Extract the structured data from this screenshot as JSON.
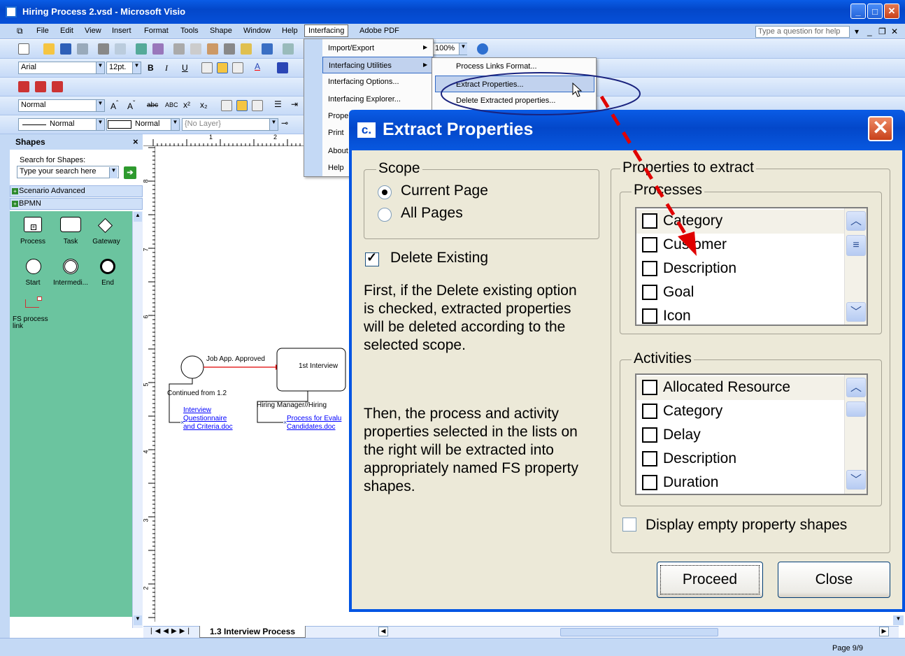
{
  "window": {
    "title": "Hiring Process 2.vsd - Microsoft Visio"
  },
  "menubar": {
    "items": [
      "File",
      "Edit",
      "View",
      "Insert",
      "Format",
      "Tools",
      "Shape",
      "Window",
      "Help",
      "Interfacing",
      "Adobe PDF"
    ],
    "help_placeholder": "Type a question for help"
  },
  "toolbar": {
    "zoom": "100%",
    "font": "Arial",
    "size": "12pt.",
    "style": "Normal",
    "line_style": "Normal",
    "fill_style": "Normal",
    "layer": "{No Layer}"
  },
  "interfacing_menu": [
    "Import/Export",
    "Interfacing Utilities",
    "Interfacing Options...",
    "Interfacing Explorer...",
    "Proper",
    "Print",
    "About",
    "Help"
  ],
  "utilities_menu": [
    "Process Links Format...",
    "Extract Properties...",
    "Delete Extracted properties..."
  ],
  "shapes_pane": {
    "title": "Shapes",
    "search_label": "Search for Shapes:",
    "search_placeholder": "Type your search here",
    "stencils": [
      "Scenario Advanced",
      "BPMN"
    ],
    "shapes": [
      "Process",
      "Task",
      "Gateway",
      "Start",
      "Intermedi...",
      "End",
      "FS process link"
    ]
  },
  "canvas": {
    "ruler_marks_h": [
      "1",
      "2"
    ],
    "ruler_marks_v": [
      "8",
      "7",
      "6",
      "5",
      "4",
      "3",
      "2"
    ],
    "edge_label": "Job App. Approved",
    "task_label": "1st Interview",
    "continued": "Continued from 1.2",
    "link1": [
      "Interview",
      "Questionnaire",
      "and Criteria.doc"
    ],
    "hiring": "Hiring Manager//Hiring",
    "link2": [
      "Process for Evalu",
      "Candidates.doc"
    ]
  },
  "page_tab": "1.3 Interview Process",
  "status": {
    "page": "Page 9/9"
  },
  "dialog": {
    "title": "Extract Properties",
    "scope_label": "Scope",
    "scope_options": [
      "Current Page",
      "All Pages"
    ],
    "delete_existing": "Delete Existing",
    "desc1": [
      "First, if the Delete existing option",
      "is checked, extracted properties",
      "will be deleted according to the",
      "selected scope."
    ],
    "desc2": [
      "Then, the process and activity",
      "properties selected in the lists on",
      "the right will be extracted into",
      "appropriately named FS property",
      "shapes."
    ],
    "props_label": "Properties to extract",
    "processes_label": "Processes",
    "processes": [
      "Category",
      "Customer",
      "Description",
      "Goal",
      "Icon"
    ],
    "activities_label": "Activities",
    "activities": [
      "Allocated Resource",
      "Category",
      "Delay",
      "Description",
      "Duration"
    ],
    "display_empty": "Display empty property shapes",
    "proceed": "Proceed",
    "close": "Close"
  },
  "colors": {
    "title_blue": "#0347c9",
    "dialog_bg": "#ece9d8",
    "stencil_green": "#6bc49f",
    "annotation_red": "#e00000",
    "annotation_navy": "#1a237e"
  }
}
